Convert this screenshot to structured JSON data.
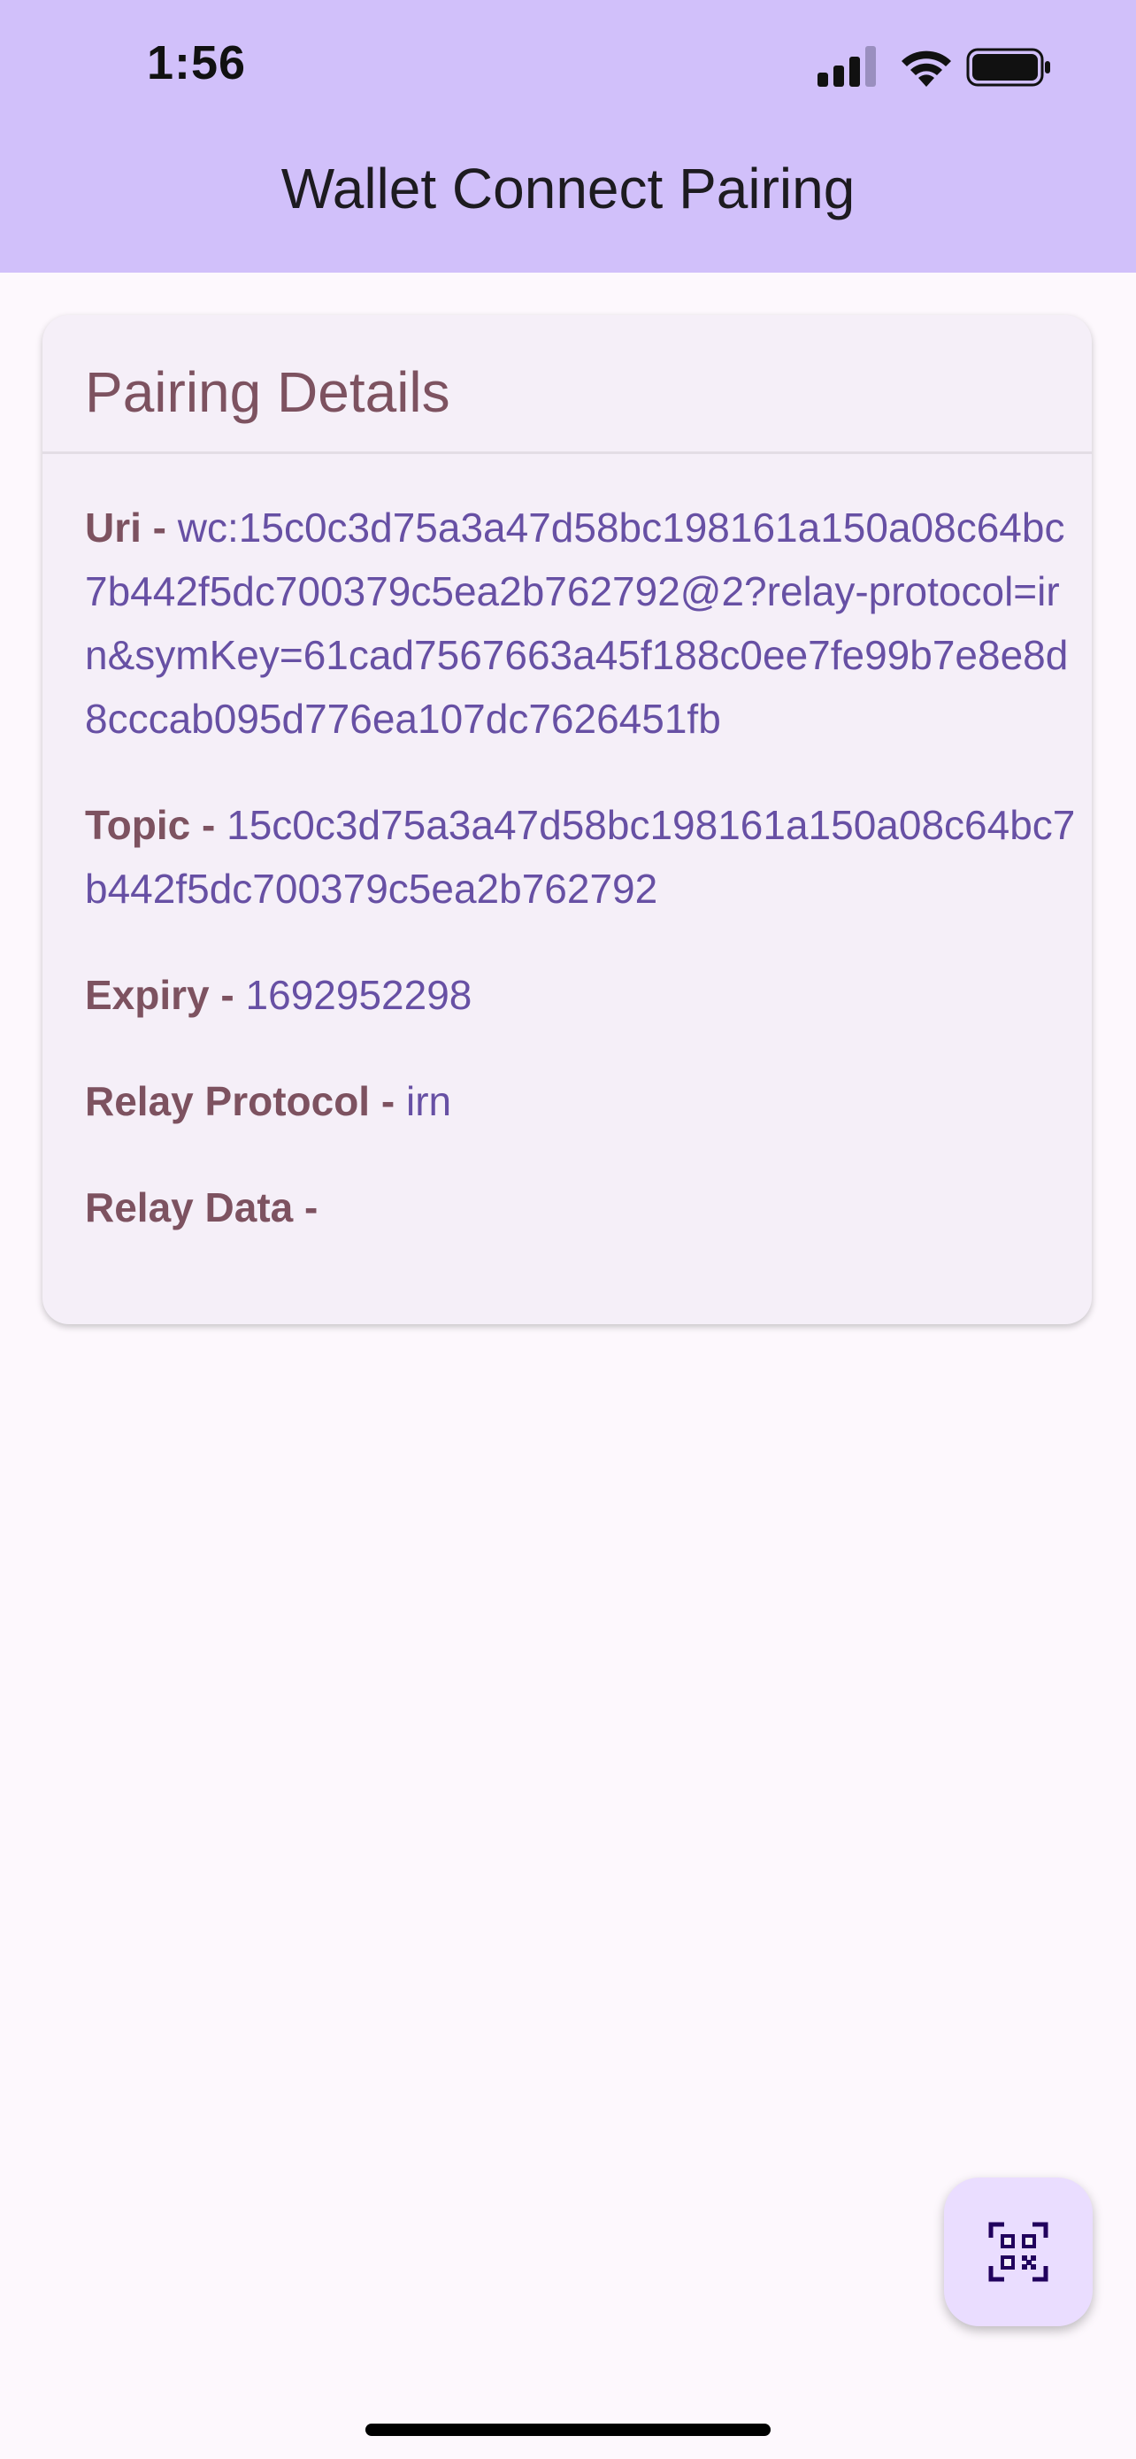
{
  "status_bar": {
    "time": "1:56",
    "signal_icon": "cellular-signal-icon",
    "wifi_icon": "wifi-icon",
    "battery_icon": "battery-icon"
  },
  "app_bar": {
    "title": "Wallet Connect Pairing",
    "color": "#d1c0fa"
  },
  "card": {
    "title": "Pairing Details",
    "rows": [
      {
        "label": "Uri",
        "separator": " - ",
        "value": "wc:15c0c3d75a3a47d58bc198161a150a08c64bc7b442f5dc700379c5ea2b762792@2?relay-protocol=irn&symKey=61cad7567663a45f188c0ee7fe99b7e8e8d8cccab095d776ea107dc7626451fb"
      },
      {
        "label": "Topic",
        "separator": " - ",
        "value": "15c0c3d75a3a47d58bc198161a150a08c64bc7b442f5dc700379c5ea2b762792"
      },
      {
        "label": "Expiry",
        "separator": " - ",
        "value": "1692952298"
      },
      {
        "label": "Relay Protocol",
        "separator": " - ",
        "value": "irn"
      },
      {
        "label": "Relay Data",
        "separator": " -",
        "value": ""
      }
    ]
  },
  "fab": {
    "icon": "qr-scan-icon",
    "color": "#eaddff"
  },
  "colors": {
    "label": "#7d5260",
    "value": "#6750a4",
    "background": "#fdf8fd"
  }
}
